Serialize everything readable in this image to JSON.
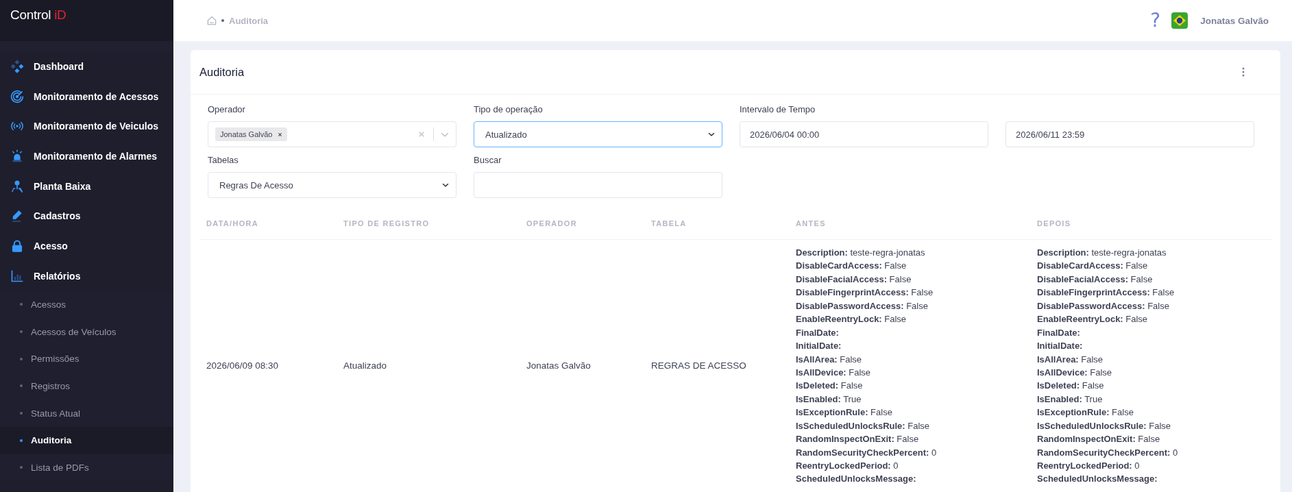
{
  "logo": {
    "text": "Control",
    "accent": "iD"
  },
  "sidebar": {
    "items": [
      {
        "label": "Dashboard"
      },
      {
        "label": "Monitoramento de Acessos"
      },
      {
        "label": "Monitoramento de Veiculos"
      },
      {
        "label": "Monitoramento de Alarmes"
      },
      {
        "label": "Planta Baixa"
      },
      {
        "label": "Cadastros"
      },
      {
        "label": "Acesso"
      },
      {
        "label": "Relatórios",
        "children": [
          {
            "label": "Acessos",
            "selected": false
          },
          {
            "label": "Acessos de Veículos",
            "selected": false
          },
          {
            "label": "Permissões",
            "selected": false
          },
          {
            "label": "Registros",
            "selected": false
          },
          {
            "label": "Status Atual",
            "selected": false
          },
          {
            "label": "Auditoria",
            "selected": true
          },
          {
            "label": "Lista de PDFs",
            "selected": false
          }
        ]
      }
    ]
  },
  "topbar": {
    "breadcrumb": [
      "Auditoria"
    ],
    "help": "?",
    "user": "Jonatas Galvão"
  },
  "card": {
    "title": "Auditoria"
  },
  "filters": [
    {
      "kind": "multiselect",
      "label": "Operador",
      "tags": [
        "Jonatas Galvão"
      ],
      "focused": false
    },
    {
      "kind": "select",
      "label": "Tipo de operação",
      "value": "Atualizado",
      "focused": true
    },
    {
      "kind": "date",
      "label": "Intervalo de Tempo",
      "value": "2026/06/04 00:00",
      "focused": false
    },
    {
      "kind": "date",
      "value": "2026/06/11 23:59",
      "focused": false
    },
    {
      "kind": "select",
      "label": "Tabelas",
      "value": "Regras De Acesso",
      "focused": false
    },
    {
      "kind": "text",
      "label": "Buscar",
      "focused": false
    }
  ],
  "table": {
    "columns": [
      "DATA/HORA",
      "TIPO DE REGISTRO",
      "OPERADOR",
      "TABELA",
      "ANTES",
      "DEPOIS"
    ],
    "rows": [
      {
        "cells": [
          "2026/06/09 08:30",
          "Atualizado",
          "Jonatas Galvão",
          "REGRAS DE ACESSO"
        ],
        "before": [
          {
            "key": "Description:",
            "value": "teste-regra-jonatas"
          },
          {
            "key": "DisableCardAccess:",
            "value": "False"
          },
          {
            "key": "DisableFacialAccess:",
            "value": "False"
          },
          {
            "key": "DisableFingerprintAccess:",
            "value": "False"
          },
          {
            "key": "DisablePasswordAccess:",
            "value": "False"
          },
          {
            "key": "EnableReentryLock:",
            "value": "False"
          },
          {
            "key": "FinalDate:"
          },
          {
            "key": "InitialDate:"
          },
          {
            "key": "IsAllArea:",
            "value": "False"
          },
          {
            "key": "IsAllDevice:",
            "value": "False"
          },
          {
            "key": "IsDeleted:",
            "value": "False"
          },
          {
            "key": "IsEnabled:",
            "value": "True"
          },
          {
            "key": "IsExceptionRule:",
            "value": "False"
          },
          {
            "key": "IsScheduledUnlocksRule:",
            "value": "False"
          },
          {
            "key": "RandomInspectOnExit:",
            "value": "False"
          },
          {
            "key": "RandomSecurityCheckPercent:",
            "value": "0"
          },
          {
            "key": "ReentryLockedPeriod:",
            "value": "0"
          },
          {
            "key": "ScheduledUnlocksMessage:"
          }
        ],
        "after": [
          {
            "key": "Description:",
            "value": "teste-regra-jonatas"
          },
          {
            "key": "DisableCardAccess:",
            "value": "False"
          },
          {
            "key": "DisableFacialAccess:",
            "value": "False"
          },
          {
            "key": "DisableFingerprintAccess:",
            "value": "False"
          },
          {
            "key": "DisablePasswordAccess:",
            "value": "False"
          },
          {
            "key": "EnableReentryLock:",
            "value": "False"
          },
          {
            "key": "FinalDate:"
          },
          {
            "key": "InitialDate:"
          },
          {
            "key": "IsAllArea:",
            "value": "False"
          },
          {
            "key": "IsAllDevice:",
            "value": "False"
          },
          {
            "key": "IsDeleted:",
            "value": "False"
          },
          {
            "key": "IsEnabled:",
            "value": "True"
          },
          {
            "key": "IsExceptionRule:",
            "value": "False"
          },
          {
            "key": "IsScheduledUnlocksRule:",
            "value": "False"
          },
          {
            "key": "RandomInspectOnExit:",
            "value": "False"
          },
          {
            "key": "RandomSecurityCheckPercent:",
            "value": "0"
          },
          {
            "key": "ReentryLockedPeriod:",
            "value": "0"
          },
          {
            "key": "ScheduledUnlocksMessage:"
          }
        ]
      }
    ]
  }
}
